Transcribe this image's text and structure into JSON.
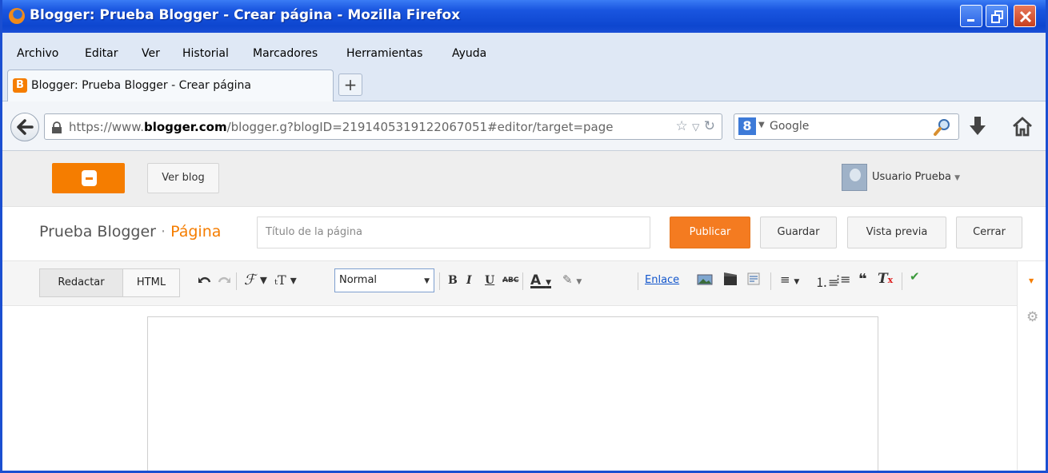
{
  "window": {
    "title": "Blogger: Prueba Blogger - Crear página - Mozilla Firefox"
  },
  "menu": [
    "Archivo",
    "Editar",
    "Ver",
    "Historial",
    "Marcadores",
    "Herramientas",
    "Ayuda"
  ],
  "tab": {
    "title": "Blogger: Prueba Blogger - Crear página",
    "new_tab": "+"
  },
  "address": {
    "prefix": "https://www.",
    "domain": "blogger.com",
    "rest": "/blogger.g?blogID=2191405319122067051#editor/target=page"
  },
  "search": {
    "engine_letter": "8",
    "placeholder": "Google"
  },
  "blogger": {
    "ver_blog": "Ver blog",
    "user": "Usuario Prueba",
    "blog_name": "Prueba Blogger",
    "separator": "·",
    "section": "Página",
    "title_placeholder": "Título de la página",
    "publish": "Publicar",
    "save": "Guardar",
    "preview": "Vista previa",
    "close": "Cerrar"
  },
  "editor": {
    "compose": "Redactar",
    "html": "HTML",
    "font_size": "Normal",
    "link": "Enlace",
    "bold": "B",
    "italic": "I",
    "underline": "U",
    "strike": "ABC"
  },
  "colors": {
    "accent": "#f57d00",
    "titlebar": "#1a56e0",
    "link": "#1155cc"
  }
}
